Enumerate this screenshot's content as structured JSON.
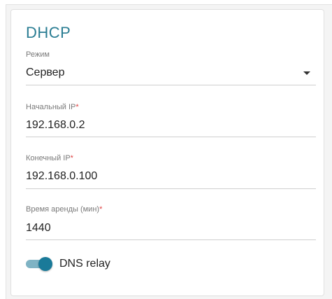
{
  "section": {
    "title": "DHCP"
  },
  "mode": {
    "label": "Режим",
    "value": "Сервер"
  },
  "start_ip": {
    "label": "Начальный IP",
    "required_mark": "*",
    "value": "192.168.0.2"
  },
  "end_ip": {
    "label": "Конечный IP",
    "required_mark": "*",
    "value": "192.168.0.100"
  },
  "lease_time": {
    "label": "Время аренды (мин)",
    "required_mark": "*",
    "value": "1440"
  },
  "dns_relay": {
    "label": "DNS relay",
    "enabled": true
  },
  "colors": {
    "title": "#2a7d93",
    "required": "#e04040",
    "toggle_on": "#1a7a99"
  }
}
